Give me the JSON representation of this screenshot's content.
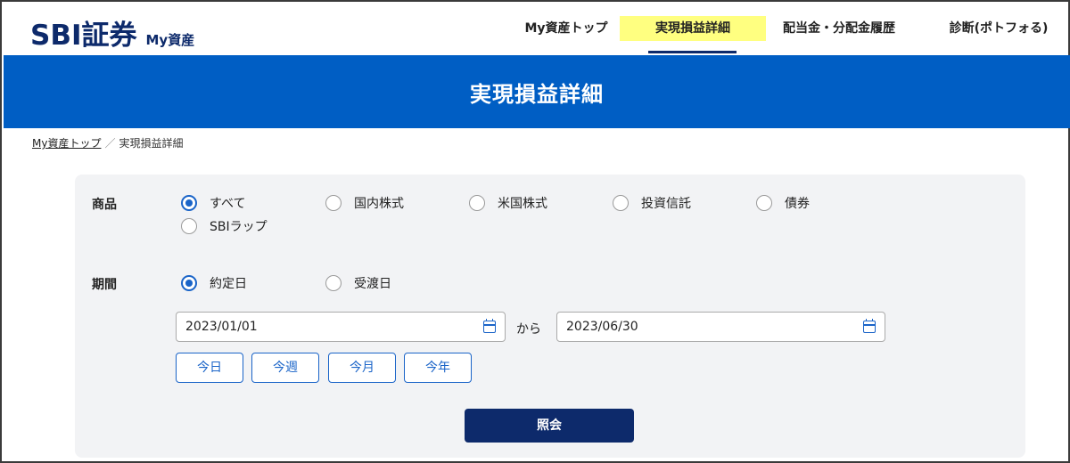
{
  "header": {
    "logo_brand": "SBI証券",
    "logo_sub": "My資産",
    "nav": [
      {
        "label": "My資産トップ",
        "active": false
      },
      {
        "label": "実現損益詳細",
        "active": true
      },
      {
        "label": "配当金・分配金履歴",
        "active": false
      },
      {
        "label": "診断(ポトフォる)",
        "active": false
      }
    ]
  },
  "page_title": "実現損益詳細",
  "breadcrumb": {
    "link": "My資産トップ",
    "separator": "／",
    "current": "実現損益詳細"
  },
  "filters": {
    "product_label": "商品",
    "product_options": [
      {
        "label": "すべて",
        "checked": true
      },
      {
        "label": "国内株式",
        "checked": false
      },
      {
        "label": "米国株式",
        "checked": false
      },
      {
        "label": "投資信託",
        "checked": false
      },
      {
        "label": "債券",
        "checked": false
      },
      {
        "label": "SBIラップ",
        "checked": false
      }
    ],
    "period_label": "期間",
    "period_options": [
      {
        "label": "約定日",
        "checked": true
      },
      {
        "label": "受渡日",
        "checked": false
      }
    ],
    "date_from": "2023/01/01",
    "range_separator": "から",
    "date_to": "2023/06/30",
    "quick_buttons": [
      "今日",
      "今週",
      "今月",
      "今年"
    ],
    "submit_label": "照会"
  },
  "colors": {
    "brand_navy": "#0d2a6b",
    "title_bar_blue": "#005ec4",
    "accent_blue": "#1a64c8",
    "active_nav_highlight": "#ffff80",
    "panel_bg": "#f2f3f5"
  },
  "icons": {
    "calendar": "calendar-icon",
    "radio": "radio-button"
  }
}
